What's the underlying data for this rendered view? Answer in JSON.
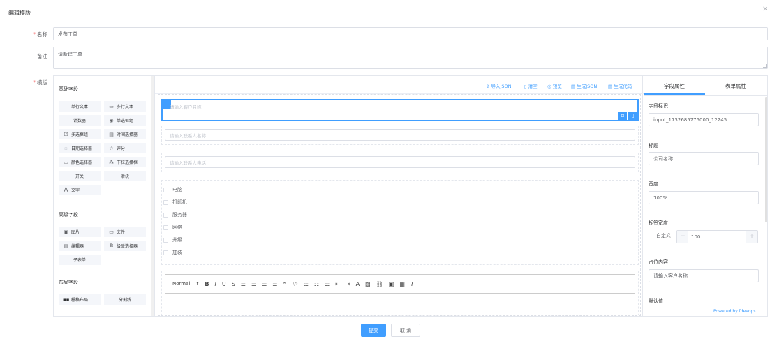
{
  "dialog": {
    "title": "编辑模版",
    "close_icon": "close-icon"
  },
  "form": {
    "name_label": "名称",
    "name_value": "发布工单",
    "remark_label": "备注",
    "remark_value": "请新建工单",
    "template_label": "模版"
  },
  "left": {
    "basic_title": "基础字段",
    "basic_items": [
      {
        "label": "单行文本",
        "icon": ""
      },
      {
        "label": "多行文本",
        "icon": "textarea-icon"
      },
      {
        "label": "计数器",
        "icon": ""
      },
      {
        "label": "单选框组",
        "icon": "radio-icon"
      },
      {
        "label": "多选框组",
        "icon": "checkbox-icon"
      },
      {
        "label": "时间选择器",
        "icon": "clock-icon"
      },
      {
        "label": "日期选择器",
        "icon": "calendar-icon"
      },
      {
        "label": "评分",
        "icon": "star-icon"
      },
      {
        "label": "颜色选择器",
        "icon": "color-icon"
      },
      {
        "label": "下拉选择框",
        "icon": "select-icon"
      },
      {
        "label": "开关",
        "icon": ""
      },
      {
        "label": "滑块",
        "icon": ""
      },
      {
        "label": "文字",
        "icon": "text-icon"
      }
    ],
    "advanced_title": "高级字段",
    "advanced_items": [
      {
        "label": "图片",
        "icon": "image-icon"
      },
      {
        "label": "文件",
        "icon": "file-icon"
      },
      {
        "label": "编辑器",
        "icon": "editor-icon"
      },
      {
        "label": "级联选择器",
        "icon": "cascader-icon"
      },
      {
        "label": "子表单",
        "icon": ""
      }
    ],
    "layout_title": "布局字段",
    "layout_items": [
      {
        "label": "栅格布局",
        "icon": "grid-icon"
      },
      {
        "label": "分割线",
        "icon": ""
      }
    ]
  },
  "toolbar": {
    "import_json": "导入JSON",
    "clear": "清空",
    "preview": "预览",
    "gen_json": "生成JSON",
    "gen_code": "生成代码"
  },
  "canvas": {
    "field1_placeholder": "请输入客户名称",
    "field2_placeholder": "请输入联系人名称",
    "field3_placeholder": "请输入联系人电话",
    "checkbox_options": [
      "电脑",
      "打印机",
      "服务器",
      "网络",
      "升级",
      "加装"
    ],
    "rte_format": "Normal"
  },
  "right": {
    "tab_field": "字段属性",
    "tab_form": "表单属性",
    "field_id_label": "字段标识",
    "field_id_value": "input_1732685775000_12245",
    "title_label": "标题",
    "title_value": "公司名称",
    "width_label": "宽度",
    "width_value": "100%",
    "label_width_label": "标签宽度",
    "custom_label": "自定义",
    "label_width_value": "100",
    "placeholder_label": "占位内容",
    "placeholder_value": "请输入客户名称",
    "default_label": "默认值",
    "powered": "Powered by fdevops"
  },
  "footer": {
    "submit": "提交",
    "cancel": "取 消"
  },
  "colors": {
    "primary": "#409eff",
    "required": "#f56c6c"
  }
}
